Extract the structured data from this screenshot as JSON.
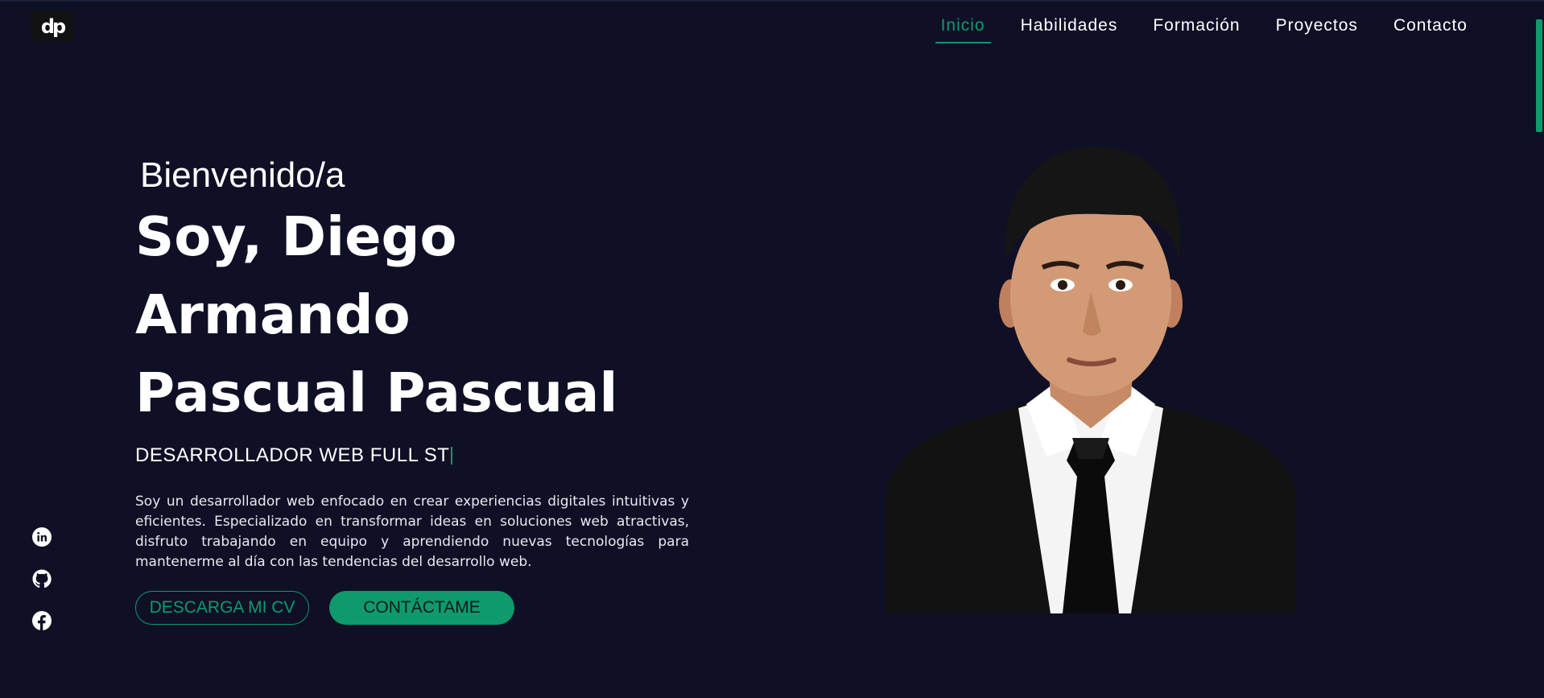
{
  "logo": {
    "text": "dp"
  },
  "nav": {
    "items": [
      {
        "label": "Inicio",
        "active": true
      },
      {
        "label": "Habilidades",
        "active": false
      },
      {
        "label": "Formación",
        "active": false
      },
      {
        "label": "Proyectos",
        "active": false
      },
      {
        "label": "Contacto",
        "active": false
      }
    ]
  },
  "hero": {
    "greeting": "Bienvenido/a",
    "name_line1": "Soy, Diego Armando",
    "name_line2": "Pascual Pascual",
    "role": "DESARROLLADOR WEB FULL ST",
    "description": "Soy un desarrollador web enfocado en crear experiencias digitales intuitivas y eficientes. Especializado en transformar ideas en soluciones web atractivas, disfruto trabajando en equipo y aprendiendo nuevas tecnologías para mantenerme al día con las tendencias del desarrollo web.",
    "download_cv_label": "DESCARGA MI CV",
    "contact_label": "CONTÁCTAME"
  },
  "social": {
    "icons": [
      "linkedin-icon",
      "github-icon",
      "facebook-icon"
    ]
  },
  "colors": {
    "background": "#0f1026",
    "accent": "#0e9a6c",
    "text": "#ffffff"
  }
}
